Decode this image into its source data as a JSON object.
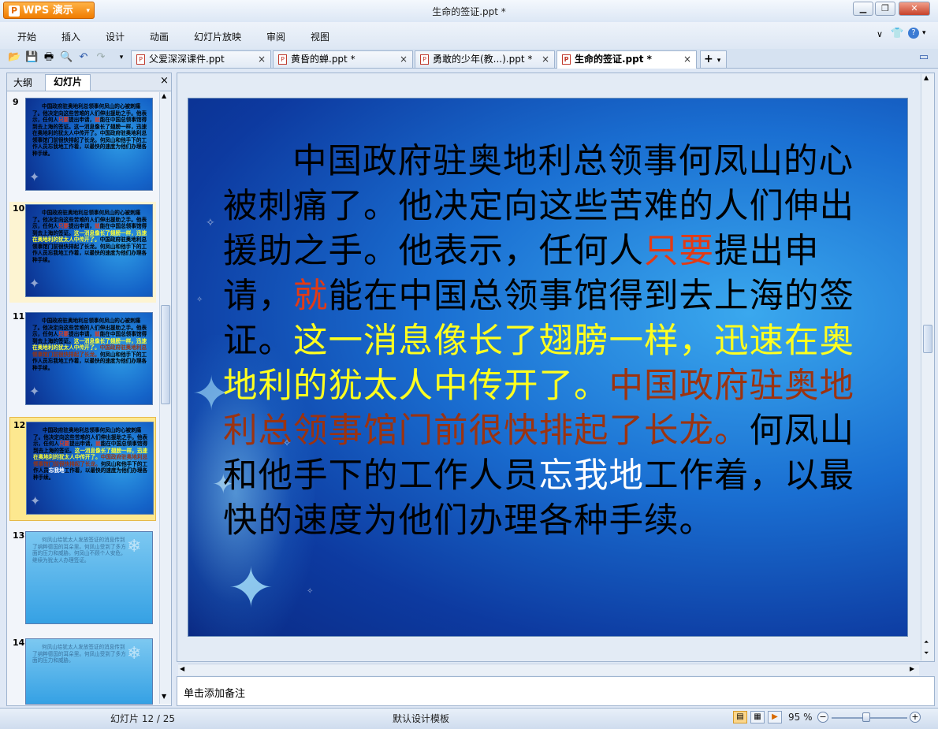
{
  "app": {
    "name": "WPS 演示",
    "window_title": "生命的签证.ppt *"
  },
  "menu": [
    "开始",
    "插入",
    "设计",
    "动画",
    "幻灯片放映",
    "审阅",
    "视图"
  ],
  "doc_tabs": [
    {
      "label": "父爱深深课件.ppt",
      "active": false
    },
    {
      "label": "黄昏的蝉.ppt *",
      "active": false
    },
    {
      "label": "勇敢的少年(教...).ppt *",
      "active": false
    },
    {
      "label": "生命的签证.ppt *",
      "active": true
    }
  ],
  "left_pane": {
    "tabs": [
      "大纲",
      "幻灯片"
    ],
    "active_tab": "幻灯片",
    "thumbnails": [
      {
        "num": "9",
        "selected": false
      },
      {
        "num": "10",
        "selected": false
      },
      {
        "num": "11",
        "selected": false
      },
      {
        "num": "12",
        "selected": true
      },
      {
        "num": "13",
        "selected": false
      },
      {
        "num": "14",
        "selected": false
      }
    ]
  },
  "slide": {
    "segments": [
      {
        "text": "中国政府驻奥地利总领事何凤山的心被刺痛了。他决定向这些苦难的人们伸出援助之手。他表示，任何人",
        "color": "black"
      },
      {
        "text": "只要",
        "color": "red"
      },
      {
        "text": "提出申请，",
        "color": "black"
      },
      {
        "text": "就",
        "color": "red"
      },
      {
        "text": "能在中国总领事馆得到去上海的签证。",
        "color": "black"
      },
      {
        "text": "这一消息像长了翅膀一样，迅速在奥地利的犹太人中传开了。",
        "color": "yellow"
      },
      {
        "text": "中国政府驻奥地利总领事馆门前很快排起了长龙。",
        "color": "brown"
      },
      {
        "text": "何凤山和他手下的工作人员",
        "color": "black"
      },
      {
        "text": "忘我地",
        "color": "white"
      },
      {
        "text": "工作着，以最快的速度为他们办理各种手续。",
        "color": "black"
      }
    ],
    "colors": {
      "red": "#e33a14",
      "yellow": "#ffff1f",
      "brown": "#9c3310",
      "white": "#ffffff",
      "black": "#000000"
    }
  },
  "notes_placeholder": "单击添加备注",
  "status": {
    "slide_counter": "幻灯片 12 / 25",
    "template": "默认设计模板",
    "zoom": "95 %"
  }
}
